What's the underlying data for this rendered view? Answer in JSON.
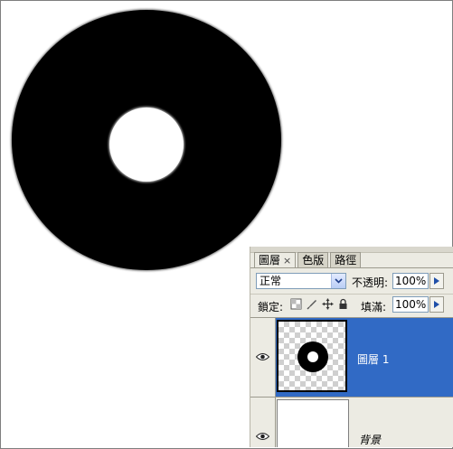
{
  "panel": {
    "tabs": [
      {
        "label": "圖層",
        "active": true,
        "close": "×"
      },
      {
        "label": "色版",
        "active": false
      },
      {
        "label": "路徑",
        "active": false
      }
    ],
    "blend_mode": "正常",
    "opacity_label": "不透明:",
    "opacity_value": "100%",
    "lock_label": "鎖定:",
    "fill_label": "填滿:",
    "fill_value": "100%",
    "layers": [
      {
        "name": "圖層 1",
        "selected": true,
        "visible": true
      },
      {
        "name": "背景",
        "selected": false,
        "visible": true
      }
    ]
  },
  "colors": {
    "selected_layer": "#316ac5",
    "panel_bg": "#ecebe3",
    "disc": "#000000"
  },
  "icons": [
    "close-icon",
    "chevron-down-icon",
    "triangle-right-icon",
    "lock-transparent-icon",
    "lock-image-icon",
    "lock-position-icon",
    "lock-all-icon",
    "eye-icon"
  ]
}
